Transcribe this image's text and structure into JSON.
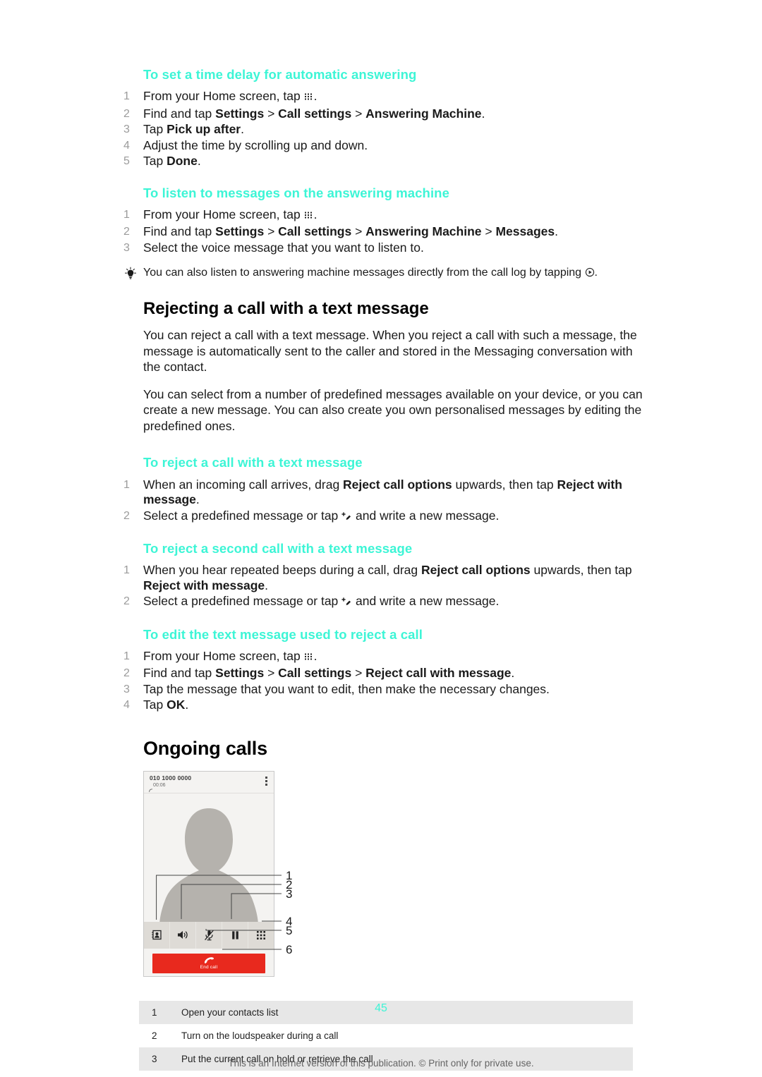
{
  "page": {
    "number": "45",
    "footnote": "This is an Internet version of this publication. © Print only for private use.",
    "heading_color": "#3DF5D6"
  },
  "sections": {
    "time_delay": {
      "heading": "To set a time delay for automatic answering",
      "steps": [
        {
          "pre": "From your Home screen, tap ",
          "icon": "app-grid-icon",
          "post": "."
        },
        {
          "pre": "Find and tap ",
          "b1": "Settings",
          "sep1": " > ",
          "b2": "Call settings",
          "sep2": " > ",
          "b3": "Answering Machine",
          "post": "."
        },
        {
          "pre": "Tap ",
          "b1": "Pick up after",
          "post": "."
        },
        {
          "pre": "Adjust the time by scrolling up and down."
        },
        {
          "pre": "Tap ",
          "b1": "Done",
          "post": "."
        }
      ]
    },
    "listen_messages": {
      "heading": "To listen to messages on the answering machine",
      "steps": [
        {
          "pre": "From your Home screen, tap ",
          "icon": "app-grid-icon",
          "post": "."
        },
        {
          "pre": "Find and tap ",
          "b1": "Settings",
          "sep1": " > ",
          "b2": "Call settings",
          "sep2": " > ",
          "b3": "Answering Machine",
          "sep3": " > ",
          "b4": "Messages",
          "post": "."
        },
        {
          "pre": "Select the voice message that you want to listen to."
        }
      ]
    },
    "tip": {
      "icon": "lightbulb-icon",
      "text_before": "You can also listen to answering machine messages directly from the call log by tapping ",
      "inline_icon": "play-circle-icon",
      "text_after": "."
    },
    "rejecting": {
      "title": "Rejecting a call with a text message",
      "paragraph_1": "You can reject a call with a text message. When you reject a call with such a message, the message is automatically sent to the caller and stored in the Messaging conversation with the contact.",
      "paragraph_2": "You can select from a number of predefined messages available on your device, or you can create a new message. You can also create you own personalised messages by editing the predefined ones."
    },
    "reject_call": {
      "heading": "To reject a call with a text message",
      "step1_a": "When an incoming call arrives, drag ",
      "step1_b": "Reject call options",
      "step1_c": " upwards, then tap ",
      "step1_d": "Reject with message",
      "step1_e": ".",
      "step2_a": "Select a predefined message or tap ",
      "step2_icon": "new-message-icon",
      "step2_b": " and write a new message."
    },
    "reject_second_call": {
      "heading": "To reject a second call with a text message",
      "step1_a": "When you hear repeated beeps during a call, drag ",
      "step1_b": "Reject call options",
      "step1_c": " upwards, then tap ",
      "step1_d": "Reject with message",
      "step1_e": ".",
      "step2_a": "Select a predefined message or tap ",
      "step2_icon": "new-message-icon",
      "step2_b": " and write a new message."
    },
    "edit_reject_text": {
      "heading": "To edit the text message used to reject a call",
      "steps": [
        {
          "pre": "From your Home screen, tap ",
          "icon": "app-grid-icon",
          "post": "."
        },
        {
          "pre": "Find and tap ",
          "b1": "Settings",
          "sep1": " > ",
          "b2": "Call settings",
          "sep2": " > ",
          "b3": "Reject call with message",
          "post": "."
        },
        {
          "pre": "Tap the message that you want to edit, then make the necessary changes."
        },
        {
          "pre": "Tap ",
          "b1": "OK",
          "post": "."
        }
      ]
    },
    "ongoing_calls": {
      "title": "Ongoing calls"
    }
  },
  "figure": {
    "phone_screen": {
      "caller_number": "010 1000 0000",
      "call_timer": "00:06",
      "overflow_menu": "more-options-icon",
      "action_buttons": [
        {
          "name": "contacts-icon"
        },
        {
          "name": "loudspeaker-icon"
        },
        {
          "name": "mute-mic-icon"
        },
        {
          "name": "hold-pause-icon"
        },
        {
          "name": "keypad-icon"
        }
      ],
      "end_call_label": "End call",
      "end_call_color": "#E8291E"
    },
    "callout_numbers": [
      "1",
      "2",
      "3",
      "4",
      "5",
      "6"
    ]
  },
  "legend_table": {
    "rows": [
      {
        "num": "1",
        "desc": "Open your contacts list"
      },
      {
        "num": "2",
        "desc": "Turn on the loudspeaker during a call"
      },
      {
        "num": "3",
        "desc": "Put the current call on hold or retrieve the call"
      }
    ]
  }
}
